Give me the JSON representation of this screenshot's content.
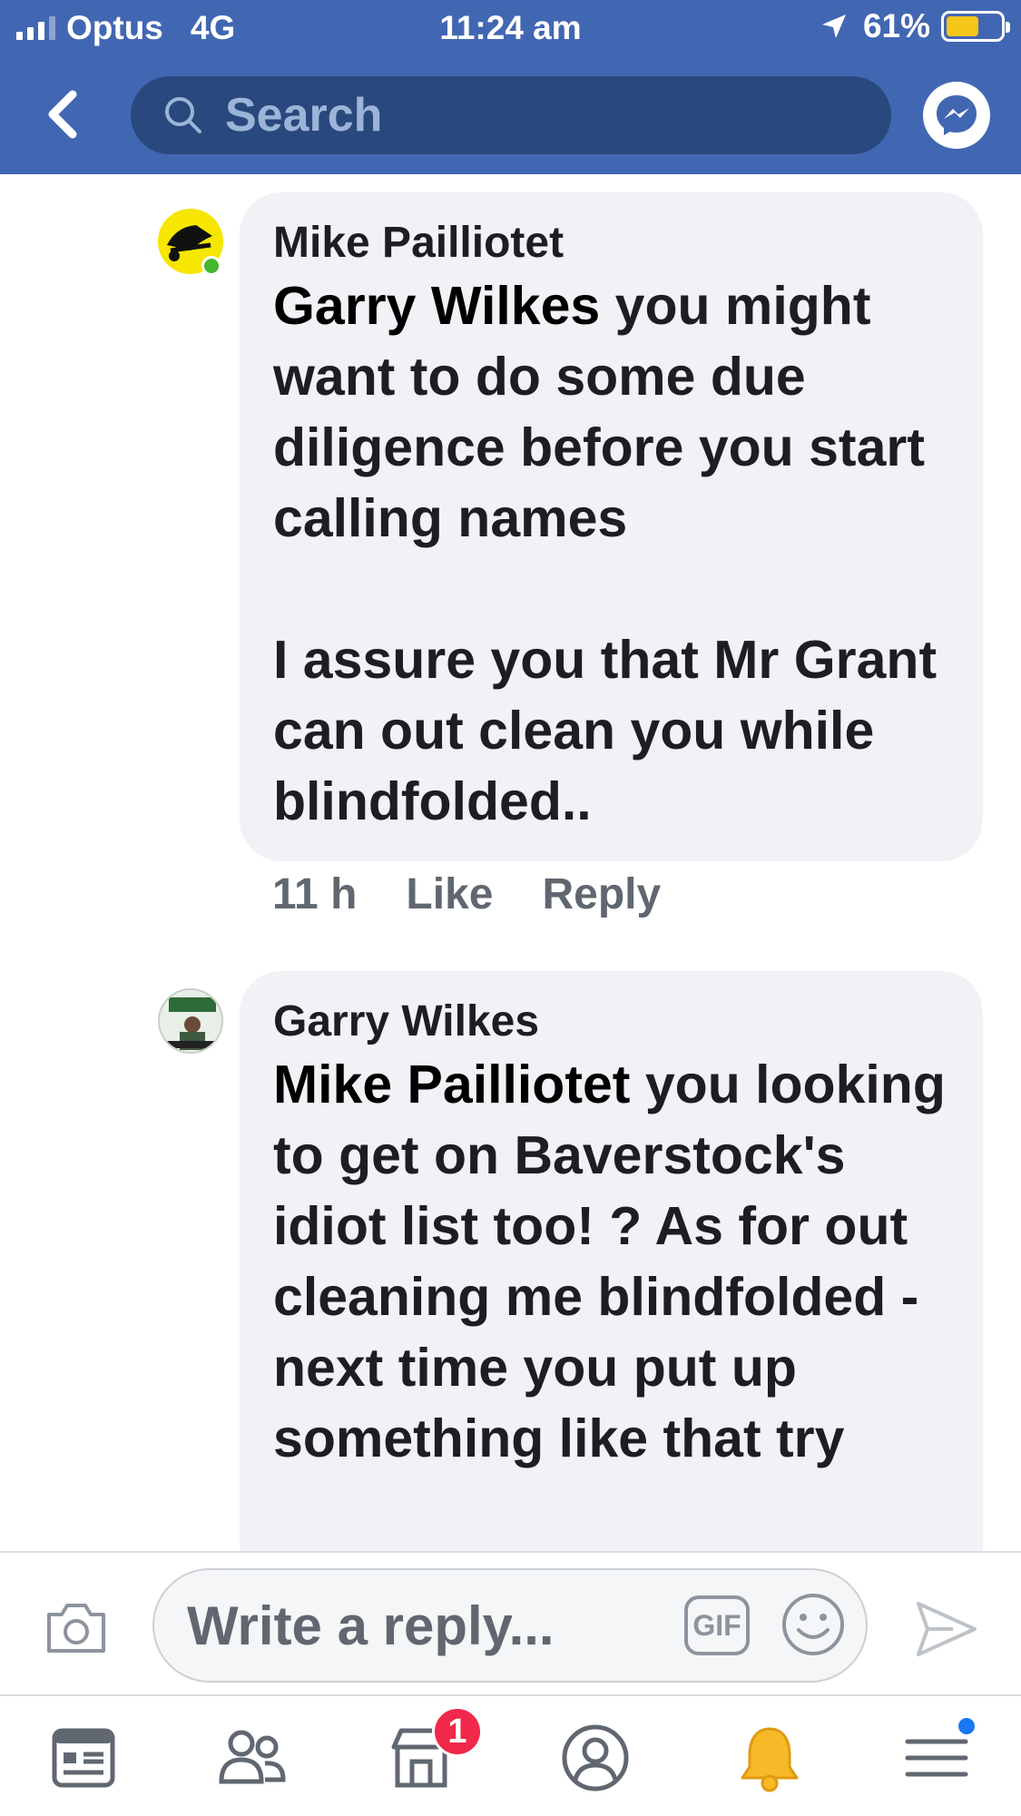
{
  "status_bar": {
    "carrier": "Optus",
    "network": "4G",
    "time": "11:24 am",
    "battery": "61%",
    "battery_level": 0.61
  },
  "header": {
    "search_placeholder": "Search"
  },
  "comments": [
    {
      "author": "Mike Pailliotet",
      "mention": "Garry Wilkes",
      "text": " you might want to do some due diligence before you start calling names\n\nI assure you that Mr Grant can out clean you while blindfolded..",
      "time": "11 h",
      "like_label": "Like",
      "reply_label": "Reply",
      "online": true
    },
    {
      "author": "Garry Wilkes",
      "mention": "Mike Pailliotet",
      "text": " you looking to get on Baverstock's idiot list too! ? As for out cleaning me blindfolded - next time you put up something like that try",
      "online": false
    }
  ],
  "reply_bar": {
    "placeholder": "Write a reply...",
    "gif_label": "GIF"
  },
  "tabbar": {
    "items": [
      "news-feed",
      "friends",
      "marketplace",
      "profile",
      "notifications",
      "menu"
    ],
    "marketplace_badge": "1"
  },
  "colors": {
    "brand": "#4267b2",
    "search_bg": "#29487d",
    "bubble": "#f0f2f5",
    "meta_text": "#606770",
    "badge": "#f02849",
    "online": "#42b72a"
  }
}
